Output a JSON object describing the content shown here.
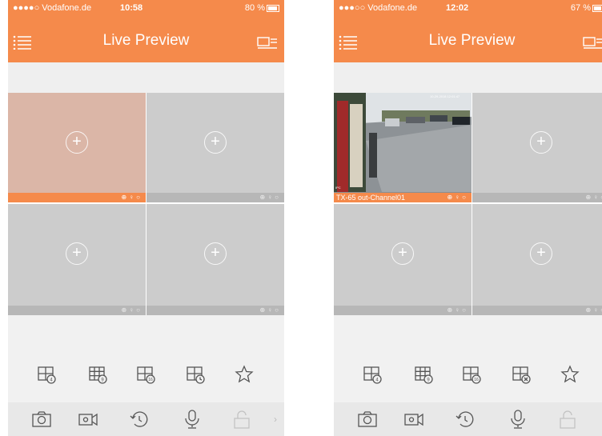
{
  "colors": {
    "accent": "#f58a4b",
    "cell_bg": "#cccccc",
    "selected_cell_bg": "#dbb6a7"
  },
  "screens": [
    {
      "status": {
        "carrier": "●●●●○ Vodafone.de",
        "time": "10:58",
        "battery": "80 %",
        "battery_level": 0.8
      },
      "nav": {
        "title": "Live Preview"
      },
      "cells": [
        {
          "label": "",
          "state": "selected"
        },
        {
          "label": "",
          "state": "empty"
        },
        {
          "label": "",
          "state": "empty"
        },
        {
          "label": "",
          "state": "empty"
        }
      ],
      "layout_buttons": [
        "grid-4-icon",
        "grid-9-icon",
        "grid-16-icon",
        "grid-history-icon",
        "star-icon"
      ],
      "action_buttons": [
        "snapshot-icon",
        "record-icon",
        "playback-icon",
        "microphone-icon",
        "lock-icon"
      ]
    },
    {
      "status": {
        "carrier": "●●●○○ Vodafone.de",
        "time": "12:02",
        "battery": "67 %",
        "battery_level": 0.67
      },
      "nav": {
        "title": "Live Preview"
      },
      "cells": [
        {
          "label": "TX-65 out-Channel01",
          "state": "live"
        },
        {
          "label": "",
          "state": "empty"
        },
        {
          "label": "",
          "state": "empty"
        },
        {
          "label": "",
          "state": "empty"
        }
      ],
      "layout_buttons": [
        "grid-4-icon",
        "grid-9-icon",
        "grid-16-icon",
        "grid-close-icon",
        "star-icon"
      ],
      "action_buttons": [
        "snapshot-icon",
        "record-icon",
        "playback-icon",
        "microphone-icon",
        "lock-icon"
      ]
    }
  ]
}
